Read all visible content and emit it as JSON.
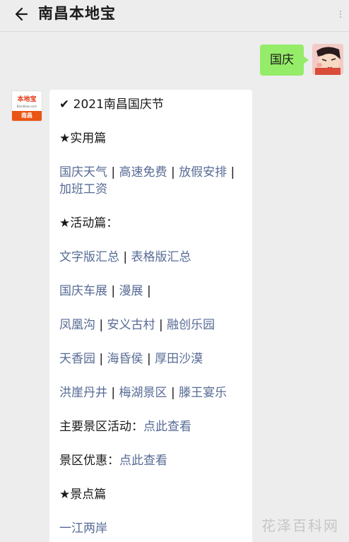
{
  "header": {
    "title": "南昌本地宝",
    "back_icon": "back-arrow-icon",
    "more_icon": "more-icon"
  },
  "outgoing": {
    "text": "国庆",
    "bubble_color": "#95ec69"
  },
  "brand": {
    "logo_text": "本地宝",
    "domain_text": "Bendibao.com",
    "city_text": "南昌",
    "accent": "#ea5414"
  },
  "card": {
    "heading": "2021南昌国庆节",
    "section1": "★实用篇",
    "links_row1": [
      "国庆天气",
      "高速免费",
      "放假安排"
    ],
    "links_row1b": [
      "加班工资"
    ],
    "section2": "★活动篇：",
    "links_row2": [
      "文字版汇总",
      "表格版汇总"
    ],
    "links_row3": [
      "国庆车展",
      "漫展"
    ],
    "links_row4": [
      "凤凰沟",
      "安义古村",
      "融创乐园"
    ],
    "links_row5": [
      "天香园",
      "海昏侯",
      "厚田沙漠"
    ],
    "links_row6": [
      "洪崖丹井",
      "梅湖景区",
      "滕王宴乐"
    ],
    "main_activity_label": "主要景区活动：",
    "main_activity_link": "点此查看",
    "discount_label": "景区优惠：",
    "discount_link": "点此查看",
    "section3": "★景点篇",
    "links_row7": [
      "一江两岸"
    ],
    "separator": "|",
    "link_color": "#576b95"
  },
  "watermark": "花泽百科网"
}
